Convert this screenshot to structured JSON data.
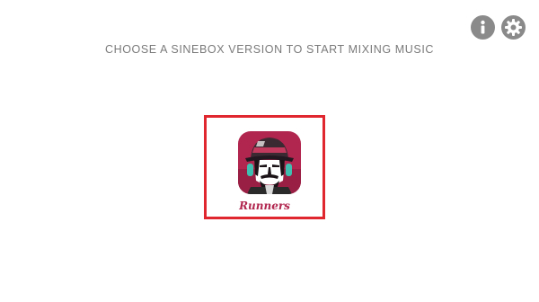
{
  "header": {
    "headline": "CHOOSE A SINEBOX VERSION TO START MIXING MUSIC",
    "info_icon": "info-icon",
    "settings_icon": "gear-icon"
  },
  "versions": [
    {
      "label": "Runners",
      "icon": "runners-app-icon",
      "selected": true
    }
  ],
  "colors": {
    "selection_border": "#e0262f",
    "label": "#b1264f",
    "icon_bg": "#b1264f",
    "headline": "#7a7a7a",
    "round_button": "#8a8a8a"
  }
}
